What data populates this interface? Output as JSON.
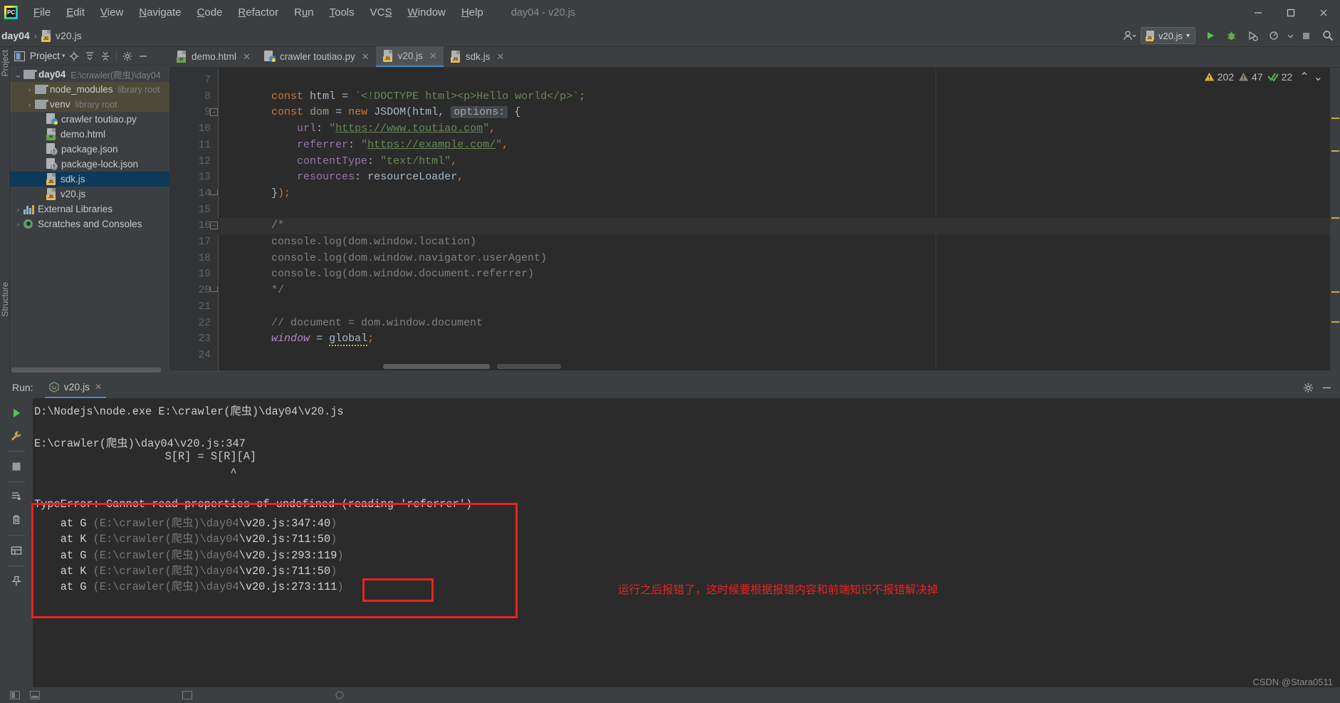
{
  "window": {
    "title": "day04 - v20.js",
    "menu": [
      "File",
      "Edit",
      "View",
      "Navigate",
      "Code",
      "Refactor",
      "Run",
      "Tools",
      "VCS",
      "Window",
      "Help"
    ],
    "controls": {
      "minimize": "─",
      "maximize": "☐",
      "close": "✕"
    }
  },
  "breadcrumb": {
    "project": "day04",
    "separator": "›",
    "file": "v20.js"
  },
  "navbar": {
    "run_config": "v20.js",
    "run_config_chevron": "▾",
    "buttons": [
      "run",
      "debug",
      "coverage",
      "profile",
      "stop",
      "search"
    ]
  },
  "project_panel": {
    "tool_label": "Project",
    "title": "Project",
    "title_chevron": "▾",
    "vertical_tabs": [
      "Project",
      "Structure"
    ],
    "header_icons": [
      "locate-icon",
      "expand-all-icon",
      "collapse-all-icon",
      "settings-icon",
      "hide-icon"
    ],
    "tree": [
      {
        "label": "day04",
        "sub": "E:\\crawler(爬虫)\\day04",
        "arrow": "⌄",
        "depth": 0,
        "icon": "folder",
        "bold": true,
        "state": "normal"
      },
      {
        "label": "node_modules",
        "sub": "library root",
        "arrow": "›",
        "depth": 1,
        "icon": "folder",
        "bold": false,
        "state": "libroot"
      },
      {
        "label": "venv",
        "sub": "library root",
        "arrow": "›",
        "depth": 1,
        "icon": "folder",
        "bold": false,
        "state": "libroot"
      },
      {
        "label": "crawler toutiao.py",
        "sub": "",
        "arrow": "",
        "depth": 2,
        "icon": "py",
        "bold": false,
        "state": "normal"
      },
      {
        "label": "demo.html",
        "sub": "",
        "arrow": "",
        "depth": 2,
        "icon": "html",
        "bold": false,
        "state": "normal"
      },
      {
        "label": "package.json",
        "sub": "",
        "arrow": "",
        "depth": 2,
        "icon": "json",
        "bold": false,
        "state": "normal"
      },
      {
        "label": "package-lock.json",
        "sub": "",
        "arrow": "",
        "depth": 2,
        "icon": "json",
        "bold": false,
        "state": "normal"
      },
      {
        "label": "sdk.js",
        "sub": "",
        "arrow": "",
        "depth": 2,
        "icon": "js",
        "bold": false,
        "state": "selected"
      },
      {
        "label": "v20.js",
        "sub": "",
        "arrow": "",
        "depth": 2,
        "icon": "js",
        "bold": false,
        "state": "normal"
      },
      {
        "label": "External Libraries",
        "sub": "",
        "arrow": "›",
        "depth": 0,
        "icon": "lib",
        "bold": false,
        "state": "normal"
      },
      {
        "label": "Scratches and Consoles",
        "sub": "",
        "arrow": "›",
        "depth": 0,
        "icon": "scratch",
        "bold": false,
        "state": "normal"
      }
    ]
  },
  "editor_tabs": [
    {
      "label": "demo.html",
      "icon": "html",
      "active": false
    },
    {
      "label": "crawler toutiao.py",
      "icon": "py",
      "active": false
    },
    {
      "label": "v20.js",
      "icon": "js",
      "active": true
    },
    {
      "label": "sdk.js",
      "icon": "js",
      "active": false
    }
  ],
  "inspections": {
    "warnings": "202",
    "weak_warnings": "47",
    "checks": "22",
    "up_arrow": "⌃",
    "down_arrow": "⌄"
  },
  "code": {
    "first_line": 7,
    "lines": [
      {
        "num": "7",
        "text": "",
        "fold": "",
        "highlight": false
      },
      {
        "num": "8",
        "text": "const html = `<!DOCTYPE html><p>Hello world</p>`;",
        "fold": "",
        "highlight": false
      },
      {
        "num": "9",
        "text": "const dom = new JSDOM(html, options: {",
        "fold": "minus",
        "highlight": false
      },
      {
        "num": "10",
        "text": "    url: \"https://www.toutiao.com\",",
        "fold": "",
        "highlight": false
      },
      {
        "num": "11",
        "text": "    referrer: \"https://example.com/\",",
        "fold": "",
        "highlight": false
      },
      {
        "num": "12",
        "text": "    contentType: \"text/html\",",
        "fold": "",
        "highlight": false
      },
      {
        "num": "13",
        "text": "    resources: resourceLoader,",
        "fold": "",
        "highlight": false
      },
      {
        "num": "14",
        "text": "});",
        "fold": "end",
        "highlight": false
      },
      {
        "num": "15",
        "text": "",
        "fold": "",
        "highlight": false
      },
      {
        "num": "16",
        "text": "/*",
        "fold": "minus",
        "highlight": true
      },
      {
        "num": "17",
        "text": "console.log(dom.window.location)",
        "fold": "",
        "highlight": false
      },
      {
        "num": "18",
        "text": "console.log(dom.window.navigator.userAgent)",
        "fold": "",
        "highlight": false
      },
      {
        "num": "19",
        "text": "console.log(dom.window.document.referrer)",
        "fold": "",
        "highlight": false
      },
      {
        "num": "20",
        "text": "*/",
        "fold": "end",
        "highlight": false
      },
      {
        "num": "21",
        "text": "",
        "fold": "",
        "highlight": false
      },
      {
        "num": "22",
        "text": "// document = dom.window.document",
        "fold": "",
        "highlight": false
      },
      {
        "num": "23",
        "text": "window = global;",
        "fold": "",
        "highlight": false
      },
      {
        "num": "24",
        "text": "",
        "fold": "",
        "highlight": false
      }
    ]
  },
  "run_panel": {
    "label": "Run:",
    "tab": "v20.js",
    "tab_close": "✕",
    "header_icons": [
      "settings-icon",
      "hide-icon"
    ],
    "toolbar_icons": [
      "rerun-icon",
      "wrench-icon",
      "stop-icon",
      "scroll-to-end-icon",
      "trash-icon",
      "layout-icon",
      "pin-icon"
    ],
    "console_lines": [
      {
        "text": "D:\\Nodejs\\node.exe E:\\crawler(爬虫)\\day04\\v20.js",
        "color": "bright"
      },
      {
        "text": "",
        "color": "bright"
      },
      {
        "text": "E:\\crawler(爬虫)\\day04\\v20.js:347",
        "color": "bright"
      },
      {
        "text": "                    S[R] = S[R][A]",
        "color": "bright"
      },
      {
        "text": "                              ^",
        "color": "bright"
      },
      {
        "text": "",
        "color": "bright"
      },
      {
        "text": "TypeError: Cannot read properties of undefined (reading 'referrer')",
        "color": "bright"
      },
      {
        "text": "    at G (E:\\crawler(爬虫)\\day04\\v20.js:347:40)",
        "color": "mixed"
      },
      {
        "text": "    at K (E:\\crawler(爬虫)\\day04\\v20.js:711:50)",
        "color": "mixed"
      },
      {
        "text": "    at G (E:\\crawler(爬虫)\\day04\\v20.js:293:119)",
        "color": "mixed"
      },
      {
        "text": "    at K (E:\\crawler(爬虫)\\day04\\v20.js:711:50)",
        "color": "mixed"
      },
      {
        "text": "    at G (E:\\crawler(爬虫)\\day04\\v20.js:273:111)",
        "color": "mixed"
      }
    ]
  },
  "annotation": {
    "text": "运行之后报错了，这时候要根据报错内容和前端知识不报错解决掉",
    "color": "#e8231f",
    "highlight_word": "'referrer')"
  },
  "watermark": "CSDN @Stara0511",
  "colors": {
    "accent": "#4a88c7",
    "annotation_red": "#e8231f",
    "editor_bg": "#2b2b2b",
    "panel_bg": "#3c3f41",
    "selected_row": "#0d3a58",
    "library_root": "#4e4a39"
  }
}
